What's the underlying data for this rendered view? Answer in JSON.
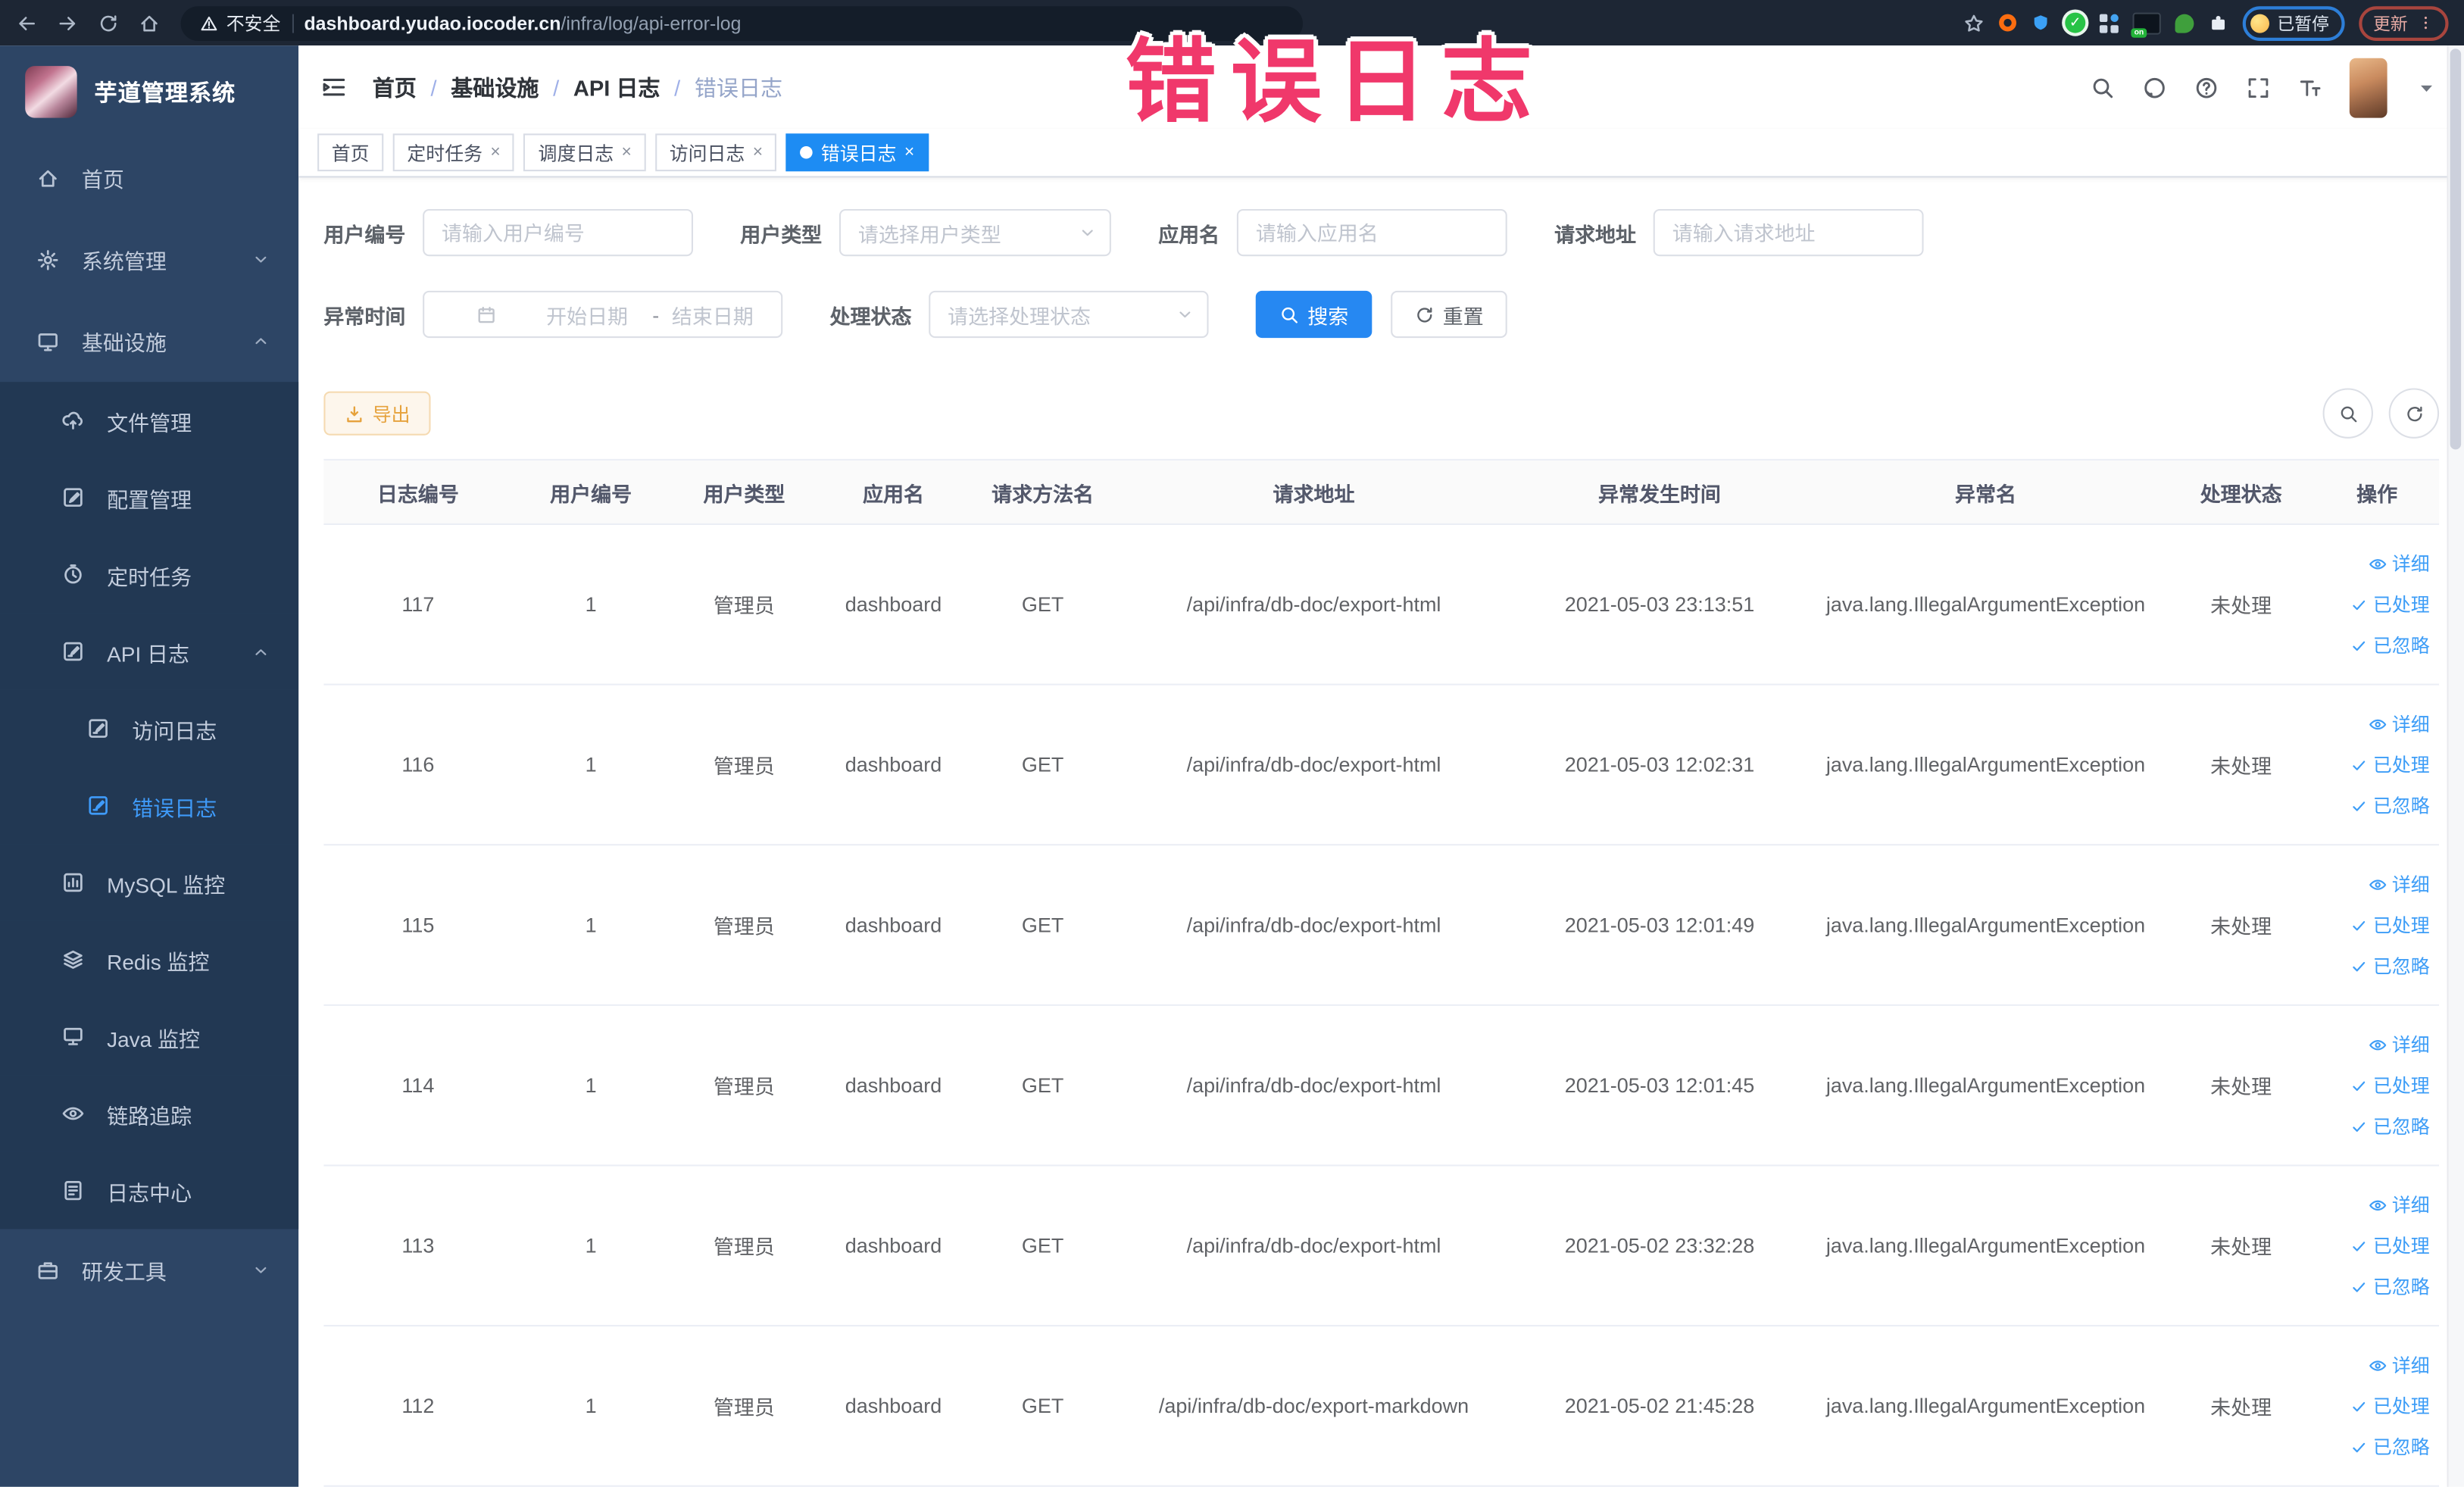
{
  "browser": {
    "security_label": "不安全",
    "url_host": "dashboard.yudao.iocoder.cn",
    "url_path": "/infra/log/api-error-log",
    "paused_label": "已暂停",
    "update_label": "更新"
  },
  "overlay": {
    "text": "错误日志",
    "color": "#f0386b"
  },
  "sidebar": {
    "title": "芋道管理系统",
    "items": [
      {
        "key": "home",
        "label": "首页",
        "icon": "home-icon",
        "level": 0,
        "dark": false,
        "active": false,
        "chevron": ""
      },
      {
        "key": "system",
        "label": "系统管理",
        "icon": "gear-icon",
        "level": 0,
        "dark": false,
        "active": false,
        "chevron": "down"
      },
      {
        "key": "infra",
        "label": "基础设施",
        "icon": "infrastructure-icon",
        "level": 0,
        "dark": false,
        "active": false,
        "chevron": "up"
      },
      {
        "key": "file-manage",
        "label": "文件管理",
        "icon": "file-manage-icon",
        "level": 1,
        "dark": true,
        "active": false,
        "chevron": ""
      },
      {
        "key": "config-manage",
        "label": "配置管理",
        "icon": "config-icon",
        "level": 1,
        "dark": true,
        "active": false,
        "chevron": ""
      },
      {
        "key": "scheduled-job",
        "label": "定时任务",
        "icon": "timer-icon",
        "level": 1,
        "dark": true,
        "active": false,
        "chevron": ""
      },
      {
        "key": "api-log",
        "label": "API 日志",
        "icon": "api-log-icon",
        "level": 1,
        "dark": true,
        "active": false,
        "chevron": "up"
      },
      {
        "key": "access-log",
        "label": "访问日志",
        "icon": "access-log-icon",
        "level": 2,
        "dark": true,
        "active": false,
        "chevron": ""
      },
      {
        "key": "error-log",
        "label": "错误日志",
        "icon": "error-log-icon",
        "level": 2,
        "dark": true,
        "active": true,
        "chevron": ""
      },
      {
        "key": "mysql-monitor",
        "label": "MySQL 监控",
        "icon": "mysql-monitor-icon",
        "level": 1,
        "dark": true,
        "active": false,
        "chevron": ""
      },
      {
        "key": "redis-monitor",
        "label": "Redis 监控",
        "icon": "redis-monitor-icon",
        "level": 1,
        "dark": true,
        "active": false,
        "chevron": ""
      },
      {
        "key": "java-monitor",
        "label": "Java 监控",
        "icon": "java-monitor-icon",
        "level": 1,
        "dark": true,
        "active": false,
        "chevron": ""
      },
      {
        "key": "trace",
        "label": "链路追踪",
        "icon": "trace-icon",
        "level": 1,
        "dark": true,
        "active": false,
        "chevron": ""
      },
      {
        "key": "log-center",
        "label": "日志中心",
        "icon": "log-center-icon",
        "level": 1,
        "dark": true,
        "active": false,
        "chevron": ""
      },
      {
        "key": "dev-tools",
        "label": "研发工具",
        "icon": "toolbox-icon",
        "level": 0,
        "dark": false,
        "active": false,
        "chevron": "down"
      }
    ]
  },
  "breadcrumb": [
    "首页",
    "基础设施",
    "API 日志",
    "错误日志"
  ],
  "tabs": [
    {
      "label": "首页",
      "closable": false,
      "active": false
    },
    {
      "label": "定时任务",
      "closable": true,
      "active": false
    },
    {
      "label": "调度日志",
      "closable": true,
      "active": false
    },
    {
      "label": "访问日志",
      "closable": true,
      "active": false
    },
    {
      "label": "错误日志",
      "closable": true,
      "active": true
    }
  ],
  "filters": {
    "fields_row1": [
      {
        "key": "user-id",
        "label": "用户编号",
        "type": "input",
        "placeholder": "请输入用户编号"
      },
      {
        "key": "user-type",
        "label": "用户类型",
        "type": "select",
        "placeholder": "请选择用户类型"
      },
      {
        "key": "app-name",
        "label": "应用名",
        "type": "input",
        "placeholder": "请输入应用名"
      },
      {
        "key": "request-url",
        "label": "请求地址",
        "type": "input",
        "placeholder": "请输入请求地址"
      }
    ],
    "fields_row2": [
      {
        "key": "exception-time",
        "label": "异常时间",
        "type": "daterange",
        "start_placeholder": "开始日期",
        "separator": "-",
        "end_placeholder": "结束日期"
      },
      {
        "key": "process-status",
        "label": "处理状态",
        "type": "select",
        "placeholder": "请选择处理状态"
      }
    ],
    "search_label": "搜索",
    "reset_label": "重置"
  },
  "toolbar": {
    "export_label": "导出"
  },
  "table": {
    "headers": [
      "日志编号",
      "用户编号",
      "用户类型",
      "应用名",
      "请求方法名",
      "请求地址",
      "异常发生时间",
      "异常名",
      "处理状态",
      "操作"
    ],
    "action_labels": [
      {
        "label": "详细",
        "icon": "eye-icon"
      },
      {
        "label": "已处理",
        "icon": "check-icon"
      },
      {
        "label": "已忽略",
        "icon": "check-icon"
      }
    ],
    "rows": [
      {
        "log_id": "117",
        "user_id": "1",
        "user_type": "管理员",
        "app_name": "dashboard",
        "method": "GET",
        "url": "/api/infra/db-doc/export-html",
        "time": "2021-05-03 23:13:51",
        "exception": "java.lang.IllegalArgumentException",
        "status": "未处理"
      },
      {
        "log_id": "116",
        "user_id": "1",
        "user_type": "管理员",
        "app_name": "dashboard",
        "method": "GET",
        "url": "/api/infra/db-doc/export-html",
        "time": "2021-05-03 12:02:31",
        "exception": "java.lang.IllegalArgumentException",
        "status": "未处理"
      },
      {
        "log_id": "115",
        "user_id": "1",
        "user_type": "管理员",
        "app_name": "dashboard",
        "method": "GET",
        "url": "/api/infra/db-doc/export-html",
        "time": "2021-05-03 12:01:49",
        "exception": "java.lang.IllegalArgumentException",
        "status": "未处理"
      },
      {
        "log_id": "114",
        "user_id": "1",
        "user_type": "管理员",
        "app_name": "dashboard",
        "method": "GET",
        "url": "/api/infra/db-doc/export-html",
        "time": "2021-05-03 12:01:45",
        "exception": "java.lang.IllegalArgumentException",
        "status": "未处理"
      },
      {
        "log_id": "113",
        "user_id": "1",
        "user_type": "管理员",
        "app_name": "dashboard",
        "method": "GET",
        "url": "/api/infra/db-doc/export-html",
        "time": "2021-05-02 23:32:28",
        "exception": "java.lang.IllegalArgumentException",
        "status": "未处理"
      },
      {
        "log_id": "112",
        "user_id": "1",
        "user_type": "管理员",
        "app_name": "dashboard",
        "method": "GET",
        "url": "/api/infra/db-doc/export-markdown",
        "time": "2021-05-02 21:45:28",
        "exception": "java.lang.IllegalArgumentException",
        "status": "未处理"
      }
    ]
  },
  "colors": {
    "accent_blue": "#1d8cf3",
    "link_blue": "#3d9df7",
    "sidebar_bg": "#2d4565",
    "sidebar_submenu_bg": "#223853",
    "sidebar_active": "#3f9bfa",
    "warning_btn_bg": "#fdf6ec",
    "warning_btn_text": "#e6a23c",
    "overlay_pink": "#f0386b",
    "browser_bar_bg": "#1d2634"
  },
  "icons": {
    "back-icon": "left-arrow",
    "forward-icon": "right-arrow",
    "reload-icon": "circular-arrow",
    "browser-home-icon": "house",
    "warning-icon": "alert-triangle",
    "star-icon": "bookmark-star",
    "extensions-puzzle-icon": "puzzle-piece",
    "menu-dots-icon": "vertical-ellipsis",
    "hamburger-icon": "fold-menu-lines",
    "search-icon": "magnifier",
    "github-icon": "octocat-circle",
    "help-icon": "question-circle",
    "fullscreen-icon": "expand-corners",
    "font-size-icon": "double-T",
    "caret-down-icon": "small-triangle-down",
    "calendar-icon": "calendar-grid",
    "refresh-icon": "circular-arrow",
    "download-icon": "down-arrow-tray",
    "eye-icon": "eye-outline",
    "check-icon": "checkmark",
    "close-icon": "x-cross",
    "chevron-down-icon": "chevron-down",
    "chevron-up-icon": "chevron-up",
    "home-icon": "house",
    "gear-icon": "cog",
    "infrastructure-icon": "monitor-stand",
    "file-manage-icon": "cloud-upload",
    "config-icon": "edit-square",
    "timer-icon": "alarm-clock",
    "api-log-icon": "edit-square",
    "access-log-icon": "edit-square",
    "error-log-icon": "edit-square",
    "mysql-monitor-icon": "bar-chart-square",
    "redis-monitor-icon": "stacked-layers",
    "java-monitor-icon": "monitor-stand",
    "trace-icon": "eye-outline",
    "log-center-icon": "document-lines",
    "toolbox-icon": "briefcase"
  }
}
